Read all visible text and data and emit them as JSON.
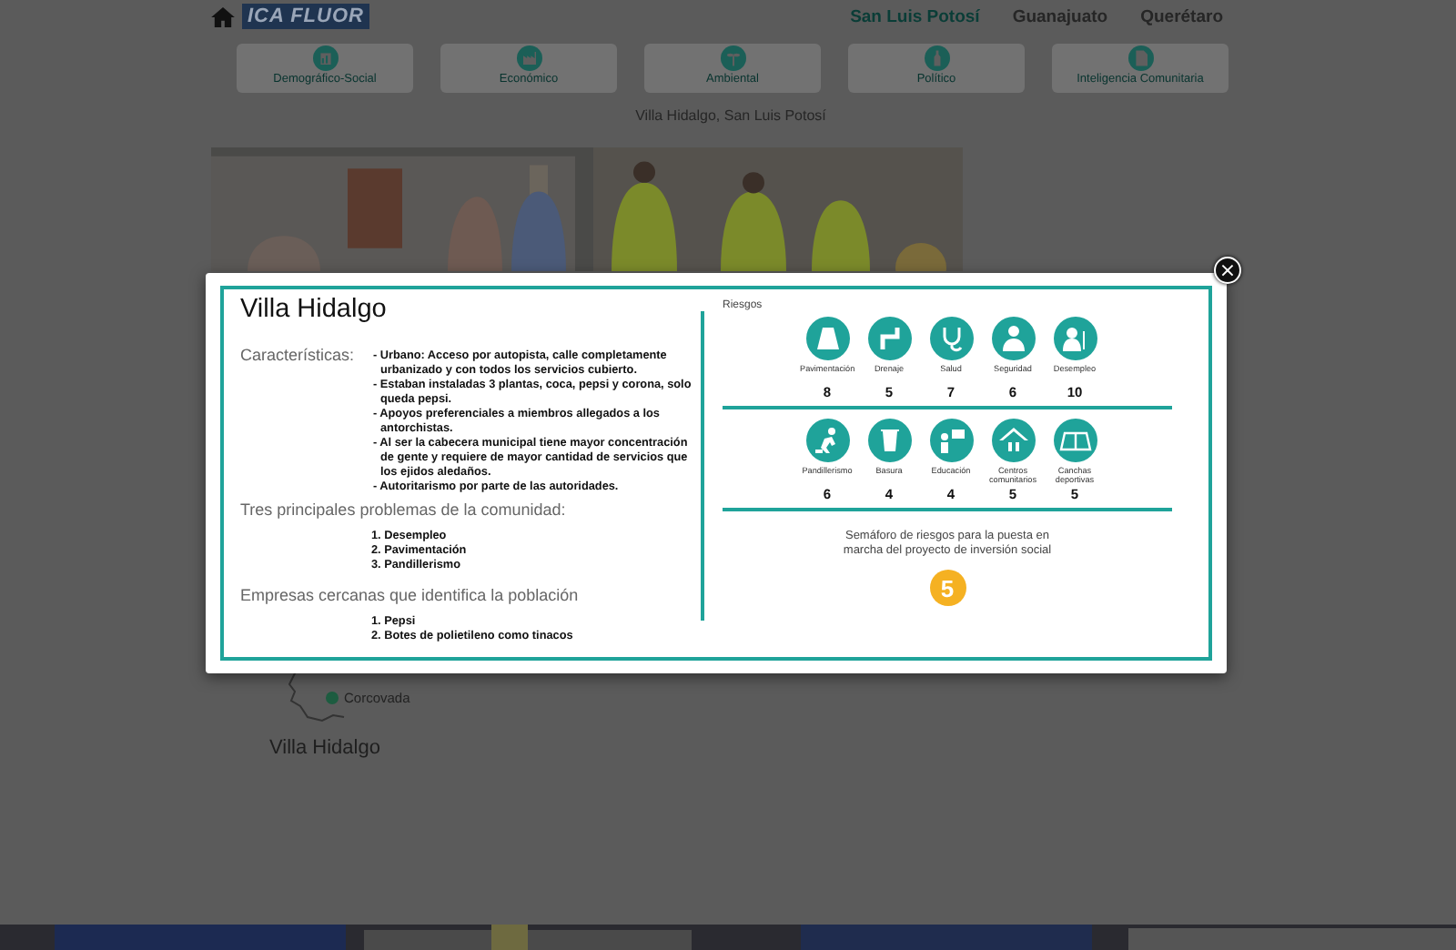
{
  "header": {
    "logo": "ICA FLUOR",
    "nav": [
      {
        "label": "San Luis Potosí",
        "selected": true
      },
      {
        "label": "Guanajuato",
        "selected": false
      },
      {
        "label": "Querétaro",
        "selected": false
      }
    ]
  },
  "categories": [
    {
      "label": "Demográfico-Social"
    },
    {
      "label": "Económico"
    },
    {
      "label": "Ambiental"
    },
    {
      "label": "Político"
    },
    {
      "label": "Inteligencia Comunitaria"
    }
  ],
  "location": "Villa Hidalgo, San Luis Potosí",
  "map": {
    "places": [
      "Corcovada"
    ],
    "title": "Villa Hidalgo"
  },
  "modal": {
    "close": "×",
    "title": "Villa Hidalgo",
    "characteristics_label": "Características:",
    "characteristics": [
      "- Urbano: Acceso por autopista, calle completamente urbanizado y con todos los servicios cubierto.",
      "- Estaban instaladas 3 plantas, coca, pepsi y corona, solo queda pepsi.",
      "- Apoyos preferenciales a miembros allegados a los antorchistas.",
      "- Al ser la cabecera municipal tiene mayor concentración de gente y requiere de mayor cantidad de servicios que los ejidos aledaños.",
      "- Autoritarismo por parte de las autoridades."
    ],
    "sections": [
      {
        "heading": "Tres principales problemas de la comunidad:",
        "items": [
          "1. Desempleo",
          "2. Pavimentación",
          "3. Pandillerismo"
        ]
      },
      {
        "heading": "Empresas cercanas que identifica la población",
        "items": [
          "1. Pepsi",
          "2. Botes de polietileno como tinacos"
        ]
      }
    ],
    "risks_label": "Riesgos",
    "risk_rows": [
      [
        {
          "label": "Pavimentación",
          "value": "8"
        },
        {
          "label": "Drenaje",
          "value": "5"
        },
        {
          "label": "Salud",
          "value": "7"
        },
        {
          "label": "Seguridad",
          "value": "6"
        },
        {
          "label": "Desempleo",
          "value": "10"
        }
      ],
      [
        {
          "label": "Pandillerismo",
          "value": "6"
        },
        {
          "label": "Basura",
          "value": "4"
        },
        {
          "label": "Educación",
          "value": "4"
        },
        {
          "label": "Centros comunitarios",
          "value": "5"
        },
        {
          "label": "Canchas deportivas",
          "value": "5"
        }
      ]
    ],
    "semaphore_text": "Semáforo de riesgos para la puesta en marcha del proyecto de inversión social",
    "semaphore_value": "5"
  }
}
